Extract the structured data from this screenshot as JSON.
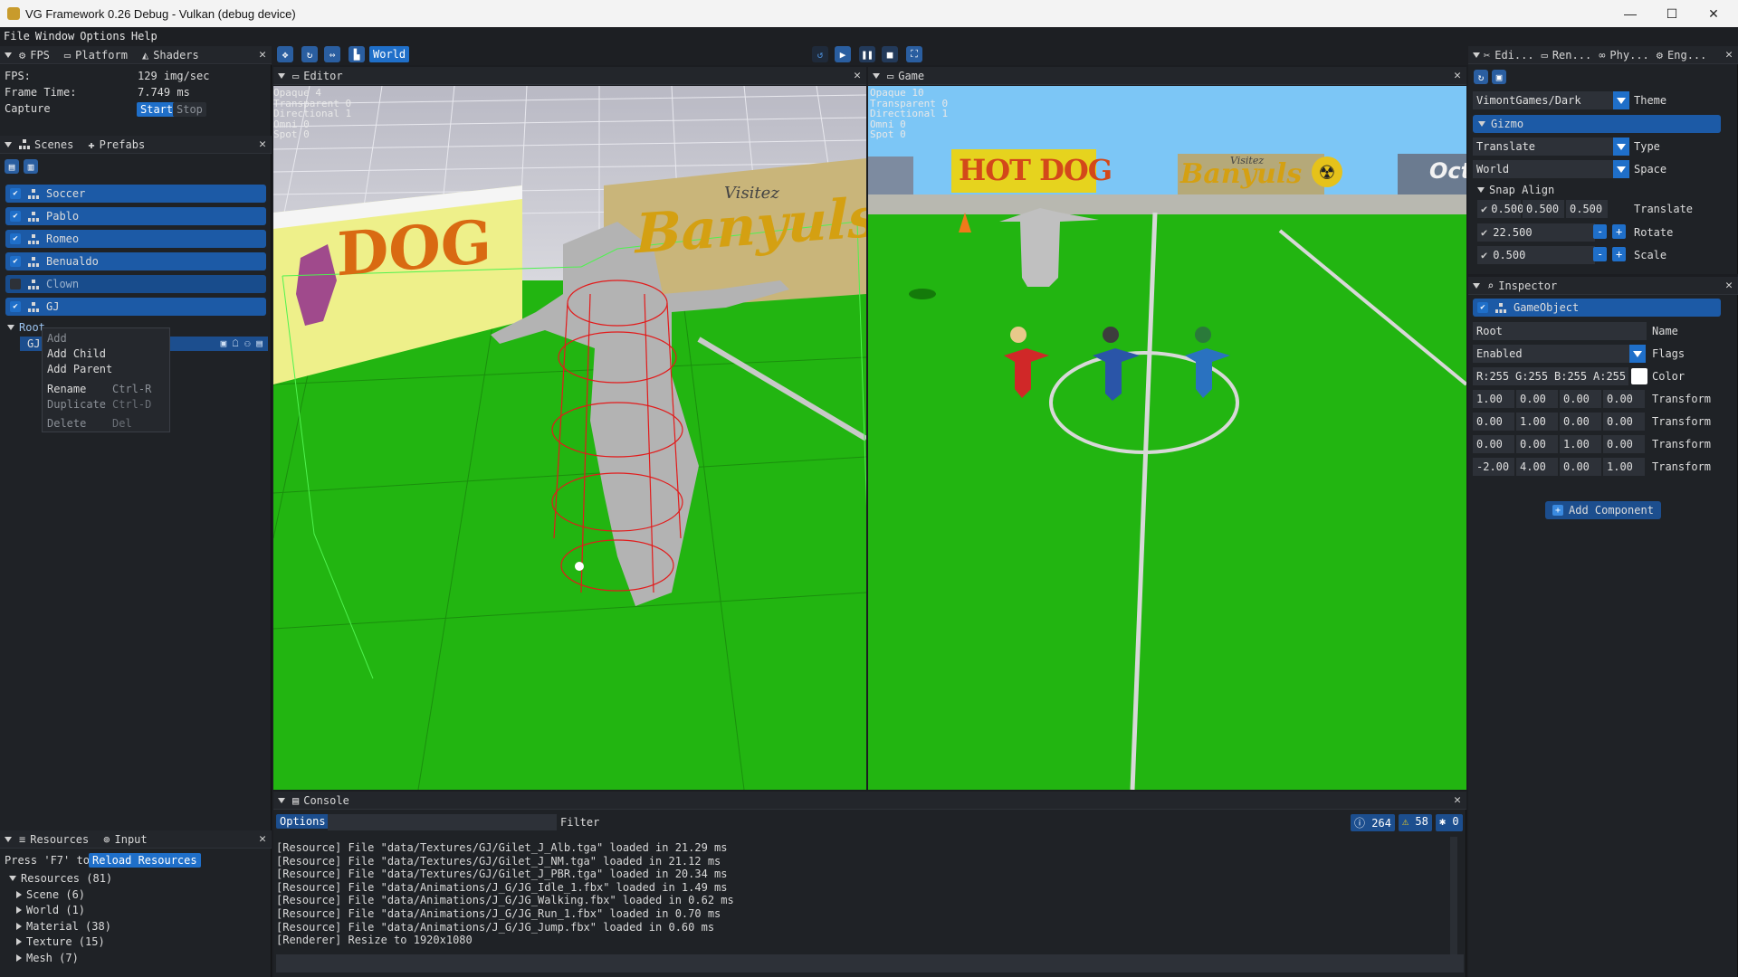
{
  "window": {
    "title": "VG Framework 0.26 Debug - Vulkan (debug device)",
    "minimize": "—",
    "maximize": "☐",
    "close": "✕"
  },
  "menu": [
    "File",
    "Window",
    "Options",
    "Help"
  ],
  "toolbar": {
    "space_label": "World"
  },
  "fps_panel": {
    "tabs": [
      "FPS",
      "Platform",
      "Shaders"
    ],
    "fps_label": "FPS:",
    "fps_value": "129 img/sec",
    "frame_label": "Frame Time:",
    "frame_value": "7.749 ms",
    "capture_label": "Capture",
    "start": "Start",
    "stop": "Stop"
  },
  "scenes_panel": {
    "tabs": [
      "Scenes",
      "Prefabs"
    ],
    "items": [
      {
        "label": "Soccer",
        "checked": true
      },
      {
        "label": "Pablo",
        "checked": true
      },
      {
        "label": "Romeo",
        "checked": true
      },
      {
        "label": "Benualdo",
        "checked": true
      },
      {
        "label": "Clown",
        "checked": false
      },
      {
        "label": "GJ",
        "checked": true
      }
    ],
    "root_label": "Root",
    "child_label": "GJ",
    "context_menu": {
      "add": "Add",
      "add_child": "Add Child",
      "add_parent": "Add Parent",
      "rename": "Rename",
      "rename_key": "Ctrl-R",
      "duplicate": "Duplicate",
      "duplicate_key": "Ctrl-D",
      "delete": "Delete",
      "delete_key": "Del"
    }
  },
  "resources_panel": {
    "tabs": [
      "Resources",
      "Input"
    ],
    "reload_prefix": "Press 'F7' to",
    "reload_button": "Reload Resources",
    "root": "Resources (81)",
    "items": [
      "Scene (6)",
      "World (1)",
      "Material (38)",
      "Texture (15)",
      "Mesh (7)"
    ]
  },
  "editor_view": {
    "tab": "Editor",
    "stats": [
      "Opaque 4",
      "Transparent 0",
      "Directional 1",
      "Omni 0",
      "Spot 0"
    ],
    "billboard_left": "DOG",
    "billboard_right_top": "Visitez",
    "billboard_right": "Banyuls"
  },
  "game_view": {
    "tab": "Game",
    "stats": [
      "Opaque 10",
      "Transparent 0",
      "Directional 1",
      "Omni 0",
      "Spot 0"
    ],
    "billboard_1": "HOT DOG",
    "billboard_2_top": "Visitez",
    "billboard_2": "Banyuls",
    "billboard_3": "Oct"
  },
  "console": {
    "tab": "Console",
    "options": "Options",
    "filter": "Filter",
    "info_count": "264",
    "warn_count": "58",
    "error_count": "0",
    "lines": [
      "[Resource] File \"data/Textures/GJ/Gilet_J_Alb.tga\" loaded in 21.29 ms",
      "[Resource] File \"data/Textures/GJ/Gilet_J_NM.tga\" loaded in 21.12 ms",
      "[Resource] File \"data/Textures/GJ/Gilet_J_PBR.tga\" loaded in 20.34 ms",
      "[Resource] File \"data/Animations/J_G/JG_Idle_1.fbx\" loaded in 1.49 ms",
      "[Resource] File \"data/Animations/J_G/JG_Walking.fbx\" loaded in 0.62 ms",
      "[Resource] File \"data/Animations/J_G/JG_Run_1.fbx\" loaded in 0.70 ms",
      "[Resource] File \"data/Animations/J_G/JG_Jump.fbx\" loaded in 0.60 ms",
      "[Renderer] Resize to 1920x1080"
    ]
  },
  "right_top_panel": {
    "tabs": [
      "Edi...",
      "Ren...",
      "Phy...",
      "Eng..."
    ],
    "theme_value": "VimontGames/Dark",
    "theme_label": "Theme",
    "gizmo_header": "Gizmo",
    "type_value": "Translate",
    "type_label": "Type",
    "space_value": "World",
    "space_label": "Space",
    "snap_header": "Snap Align",
    "snap_translate": [
      "0.500",
      "0.500",
      "0.500"
    ],
    "snap_translate_label": "Translate",
    "snap_rotate": "22.500",
    "snap_rotate_label": "Rotate",
    "snap_scale": "0.500",
    "snap_scale_label": "Scale"
  },
  "inspector": {
    "tab": "Inspector",
    "object": "GameObject",
    "name_value": "Root",
    "name_label": "Name",
    "flags_value": "Enabled",
    "flags_label": "Flags",
    "color": [
      "R:255",
      "G:255",
      "B:255",
      "A:255"
    ],
    "color_label": "Color",
    "transform_label": "Transform",
    "transform": [
      [
        "1.00",
        "0.00",
        "0.00",
        "0.00"
      ],
      [
        "0.00",
        "1.00",
        "0.00",
        "0.00"
      ],
      [
        "0.00",
        "0.00",
        "1.00",
        "0.00"
      ],
      [
        "-2.00",
        "4.00",
        "0.00",
        "1.00"
      ]
    ],
    "add_component": "Add Component"
  }
}
